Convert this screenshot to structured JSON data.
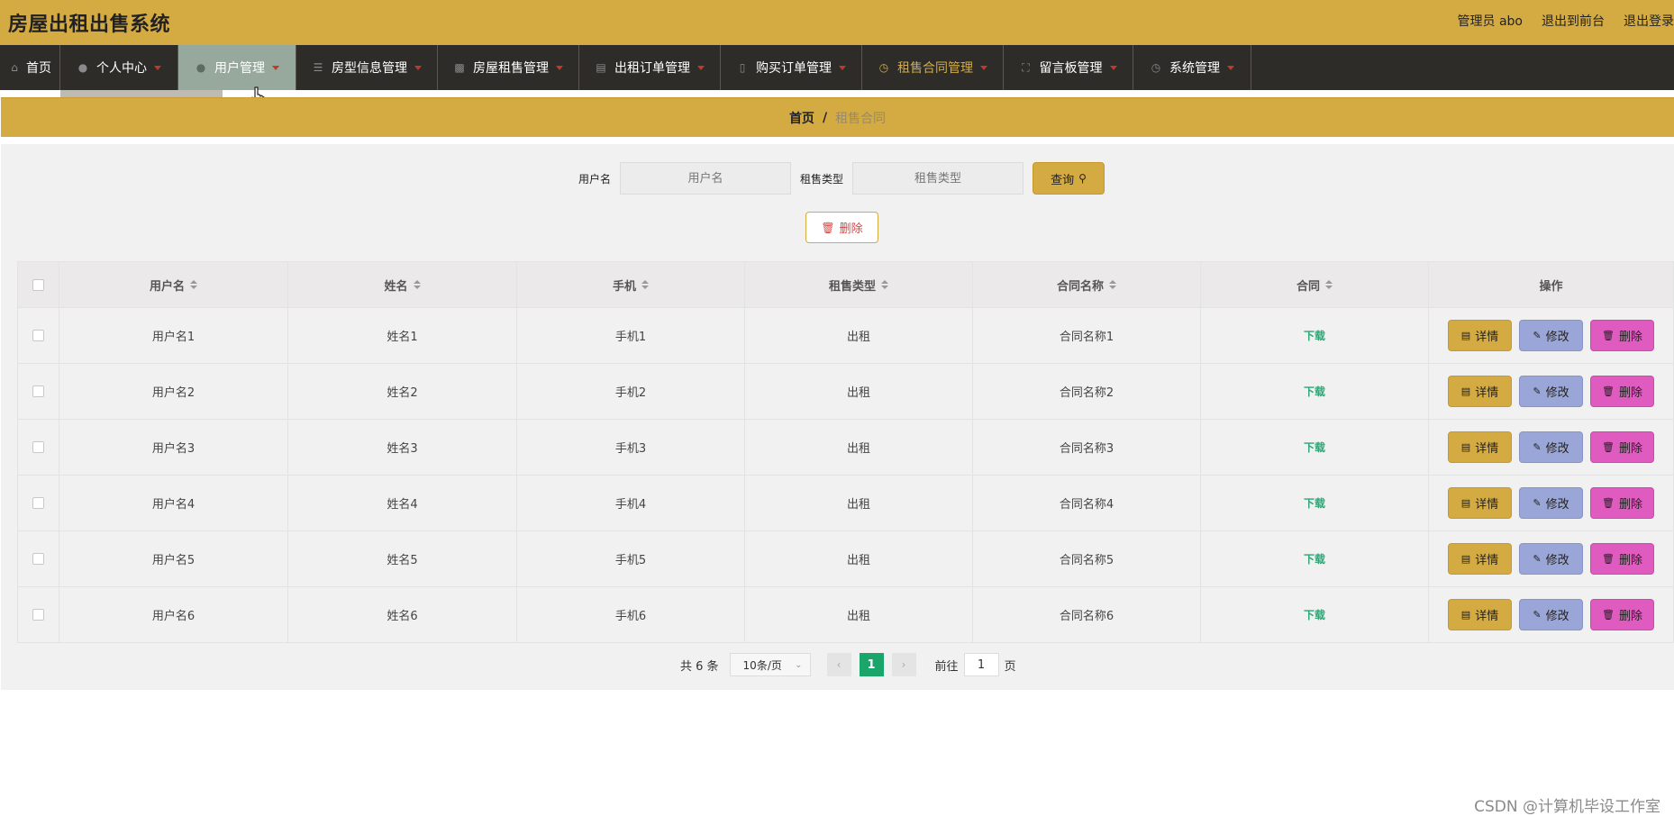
{
  "header": {
    "title": "房屋出租出售系统",
    "admin_label": "管理员 abo",
    "back_to_front": "退出到前台",
    "logout": "退出登录"
  },
  "nav": {
    "items": [
      {
        "label": "首页",
        "icon": "home-icon"
      },
      {
        "label": "个人中心",
        "icon": "user-icon"
      },
      {
        "label": "用户管理",
        "icon": "user-icon"
      },
      {
        "label": "房型信息管理",
        "icon": "list-icon"
      },
      {
        "label": "房屋租售管理",
        "icon": "chat-icon"
      },
      {
        "label": "出租订单管理",
        "icon": "chat-dots-icon"
      },
      {
        "label": "购买订单管理",
        "icon": "phone-icon"
      },
      {
        "label": "租售合同管理",
        "icon": "compass-icon"
      },
      {
        "label": "留言板管理",
        "icon": "fullscreen-icon"
      },
      {
        "label": "系统管理",
        "icon": "clock-icon"
      }
    ],
    "hover_index": 2,
    "active_index": 7
  },
  "breadcrumb": {
    "home": "首页",
    "separator": "/",
    "current": "租售合同"
  },
  "search": {
    "username_label": "用户名",
    "username_placeholder": "用户名",
    "type_label": "租售类型",
    "type_placeholder": "租售类型",
    "query_button": "查询"
  },
  "toolbar": {
    "delete_button": "删除"
  },
  "table": {
    "columns": [
      "用户名",
      "姓名",
      "手机",
      "租售类型",
      "合同名称",
      "合同",
      "操作"
    ],
    "rows": [
      {
        "username": "用户名1",
        "name": "姓名1",
        "phone": "手机1",
        "type": "出租",
        "contract_name": "合同名称1",
        "contract": "下载"
      },
      {
        "username": "用户名2",
        "name": "姓名2",
        "phone": "手机2",
        "type": "出租",
        "contract_name": "合同名称2",
        "contract": "下载"
      },
      {
        "username": "用户名3",
        "name": "姓名3",
        "phone": "手机3",
        "type": "出租",
        "contract_name": "合同名称3",
        "contract": "下载"
      },
      {
        "username": "用户名4",
        "name": "姓名4",
        "phone": "手机4",
        "type": "出租",
        "contract_name": "合同名称4",
        "contract": "下载"
      },
      {
        "username": "用户名5",
        "name": "姓名5",
        "phone": "手机5",
        "type": "出租",
        "contract_name": "合同名称5",
        "contract": "下载"
      },
      {
        "username": "用户名6",
        "name": "姓名6",
        "phone": "手机6",
        "type": "出租",
        "contract_name": "合同名称6",
        "contract": "下载"
      }
    ],
    "action_labels": {
      "detail": "详情",
      "edit": "修改",
      "delete": "删除"
    }
  },
  "pagination": {
    "total": "共 6 条",
    "page_size": "10条/页",
    "current_page": "1",
    "goto_label": "前往",
    "goto_value": "1",
    "page_suffix": "页"
  },
  "watermark": "CSDN @计算机毕设工作室",
  "colors": {
    "accent": "#d4ab43",
    "nav_bg": "#2e2c29",
    "nav_hover": "#97a99c",
    "pager_active": "#1aa56b",
    "edit_button": "#9aa6d8",
    "delete_button": "#e05bbf",
    "download_link": "#2aa876"
  }
}
